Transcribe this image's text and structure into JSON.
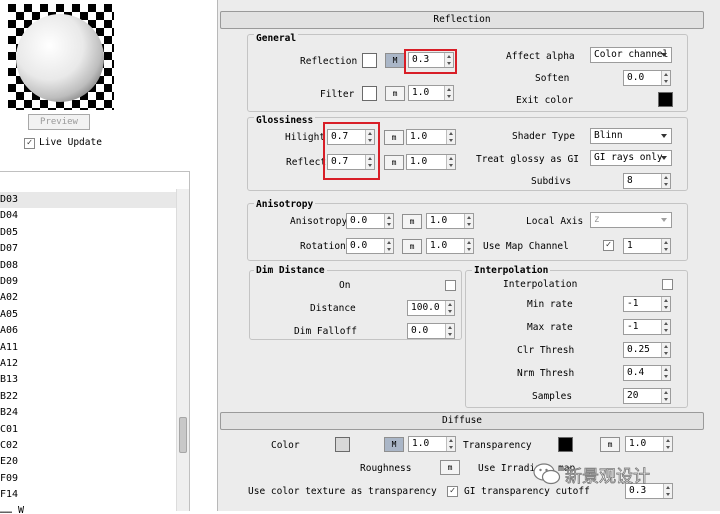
{
  "preview": {
    "button_label": "Preview",
    "live_update_label": "Live Update",
    "live_update_checked": true
  },
  "material_list": {
    "items": [
      "D03",
      "D04",
      "D05",
      "D07",
      "D08",
      "D09",
      "A02",
      "A05",
      "A06",
      "A11",
      "A12",
      "B13",
      "B22",
      "B24",
      "C01",
      "C02",
      "E20",
      "F09",
      "F14"
    ],
    "selected_index": 0,
    "cut_off_bottom": "…… W"
  },
  "reflection_rollout": {
    "title": "Reflection",
    "general": {
      "title": "General",
      "reflection_label": "Reflection",
      "reflection_value": "0.3",
      "reflection_color": "#ffffff",
      "reflection_map_label": "M",
      "filter_label": "Filter",
      "filter_value": "1.0",
      "filter_color": "#ffffff",
      "filter_map_label": "m",
      "affect_alpha_label": "Affect alpha",
      "affect_alpha_value": "Color channel",
      "soften_label": "Soften",
      "soften_value": "0.0",
      "exit_color_label": "Exit color",
      "exit_color": "#000000"
    },
    "glossiness": {
      "title": "Glossiness",
      "hilight_label": "Hilight",
      "hilight_value": "0.7",
      "hilight_map_label": "m",
      "hilight_map_value": "1.0",
      "reflect_label": "Reflect",
      "reflect_value": "0.7",
      "reflect_map_label": "m",
      "reflect_map_value": "1.0",
      "shader_type_label": "Shader Type",
      "shader_type_value": "Blinn",
      "treat_glossy_label": "Treat glossy as GI",
      "treat_glossy_value": "GI rays only",
      "subdivs_label": "Subdivs",
      "subdivs_value": "8"
    },
    "anisotropy": {
      "title": "Anisotropy",
      "anisotropy_label": "Anisotropy",
      "anisotropy_value": "0.0",
      "anisotropy_map_label": "m",
      "anisotropy_map_value": "1.0",
      "rotation_label": "Rotation",
      "rotation_value": "0.0",
      "rotation_map_label": "m",
      "rotation_map_value": "1.0",
      "local_axis_label": "Local Axis",
      "local_axis_value": "z",
      "use_map_channel_label": "Use Map Channel",
      "use_map_channel_checked": true,
      "use_map_channel_value": "1"
    },
    "dim_distance": {
      "title": "Dim Distance",
      "on_label": "On",
      "on_checked": false,
      "distance_label": "Distance",
      "distance_value": "100.0",
      "dim_falloff_label": "Dim Falloff",
      "dim_falloff_value": "0.0"
    },
    "interpolation": {
      "title": "Interpolation",
      "interpolation_label": "Interpolation",
      "interpolation_checked": false,
      "min_rate_label": "Min rate",
      "min_rate_value": "-1",
      "max_rate_label": "Max rate",
      "max_rate_value": "-1",
      "clr_thresh_label": "Clr Thresh",
      "clr_thresh_value": "0.25",
      "nrm_thresh_label": "Nrm Thresh",
      "nrm_thresh_value": "0.4",
      "samples_label": "Samples",
      "samples_value": "20"
    }
  },
  "diffuse_rollout": {
    "title": "Diffuse",
    "color_label": "Color",
    "color_swatch": "#d8d8d8",
    "color_map_label": "M",
    "color_value": "1.0",
    "transparency_label": "Transparency",
    "transparency_swatch": "#000000",
    "transparency_map_label": "m",
    "transparency_value": "1.0",
    "roughness_label": "Roughness",
    "roughness_map_label": "m",
    "use_irradiance_label": "Use Irradian… map",
    "use_color_texture_label": "Use color texture as transparency",
    "use_color_texture_checked": true,
    "gi_cutoff_label": "GI transparency cutoff",
    "gi_cutoff_value": "0.3"
  },
  "watermark": {
    "text": "新景观设计"
  },
  "colors": {
    "highlight_box": "#d81e27",
    "selected_row": "#e8e8e8",
    "map_button_active": "#aab6c7"
  }
}
